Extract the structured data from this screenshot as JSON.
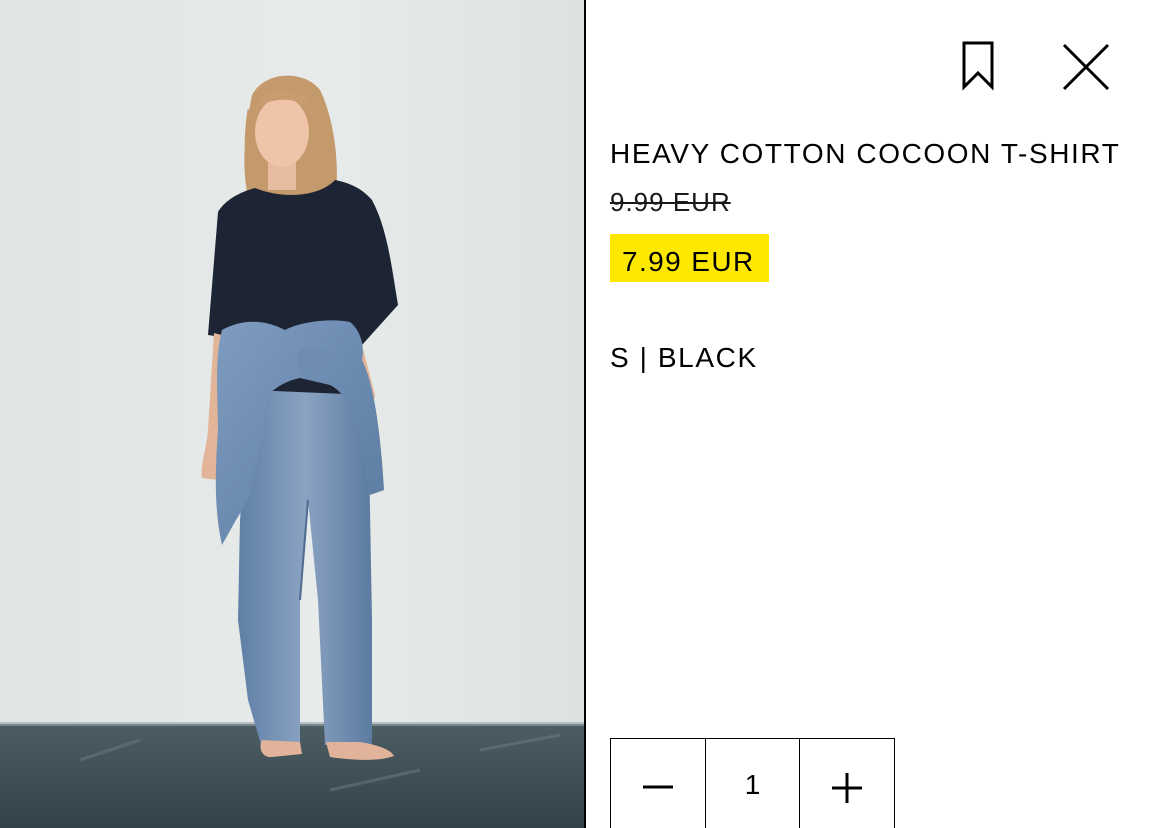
{
  "product": {
    "title": "HEAVY COTTON COCOON T-SHIRT",
    "original_price": "9.99 EUR",
    "sale_price": "7.99 EUR",
    "variant": "S | BLACK"
  },
  "quantity": {
    "value": "1",
    "decrement_icon": "minus-icon",
    "increment_icon": "plus-icon"
  },
  "header_icons": {
    "save": "bookmark-icon",
    "close": "close-icon"
  },
  "colors": {
    "sale_highlight": "#ffe800",
    "text": "#000000",
    "divider": "#000000"
  }
}
